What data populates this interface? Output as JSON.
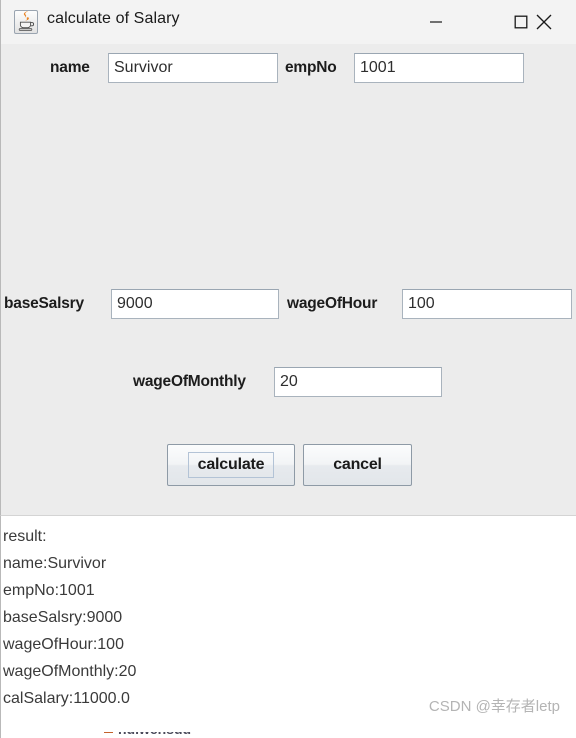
{
  "window": {
    "title": "calculate of Salary",
    "icon": "java-coffee-cup-icon",
    "controls": {
      "minimize": "minimize",
      "maximize": "maximize",
      "close": "close"
    }
  },
  "form": {
    "fields": [
      {
        "label": "name",
        "value": "Survivor",
        "placeholder": ""
      },
      {
        "label": "empNo",
        "value": "1001",
        "placeholder": ""
      },
      {
        "label": "baseSalsry",
        "value": "9000",
        "placeholder": ""
      },
      {
        "label": "wageOfHour",
        "value": "100",
        "placeholder": ""
      },
      {
        "label": "wageOfMonthly",
        "value": "20",
        "placeholder": ""
      }
    ]
  },
  "actions": {
    "calculate_label": "calculate",
    "cancel_label": "cancel"
  },
  "result": {
    "lines": [
      "result:",
      "name:Survivor",
      "empNo:1001",
      "baseSalsry:9000",
      "wageOfHour:100",
      "wageOfMonthly:20",
      "calSalary:11000.0"
    ]
  },
  "watermark": {
    "text": "CSDN @幸存者letp"
  },
  "underflow": {
    "text": "nuiwensuu"
  },
  "colors": {
    "panel": "#ececec",
    "titlebar": "#f3f3f3",
    "field_bg": "#ffffff",
    "field_border": "#a9b3bd",
    "text": "#1c1c1c",
    "result_text": "#3a3a3a",
    "watermark": "#b4b4b4"
  }
}
